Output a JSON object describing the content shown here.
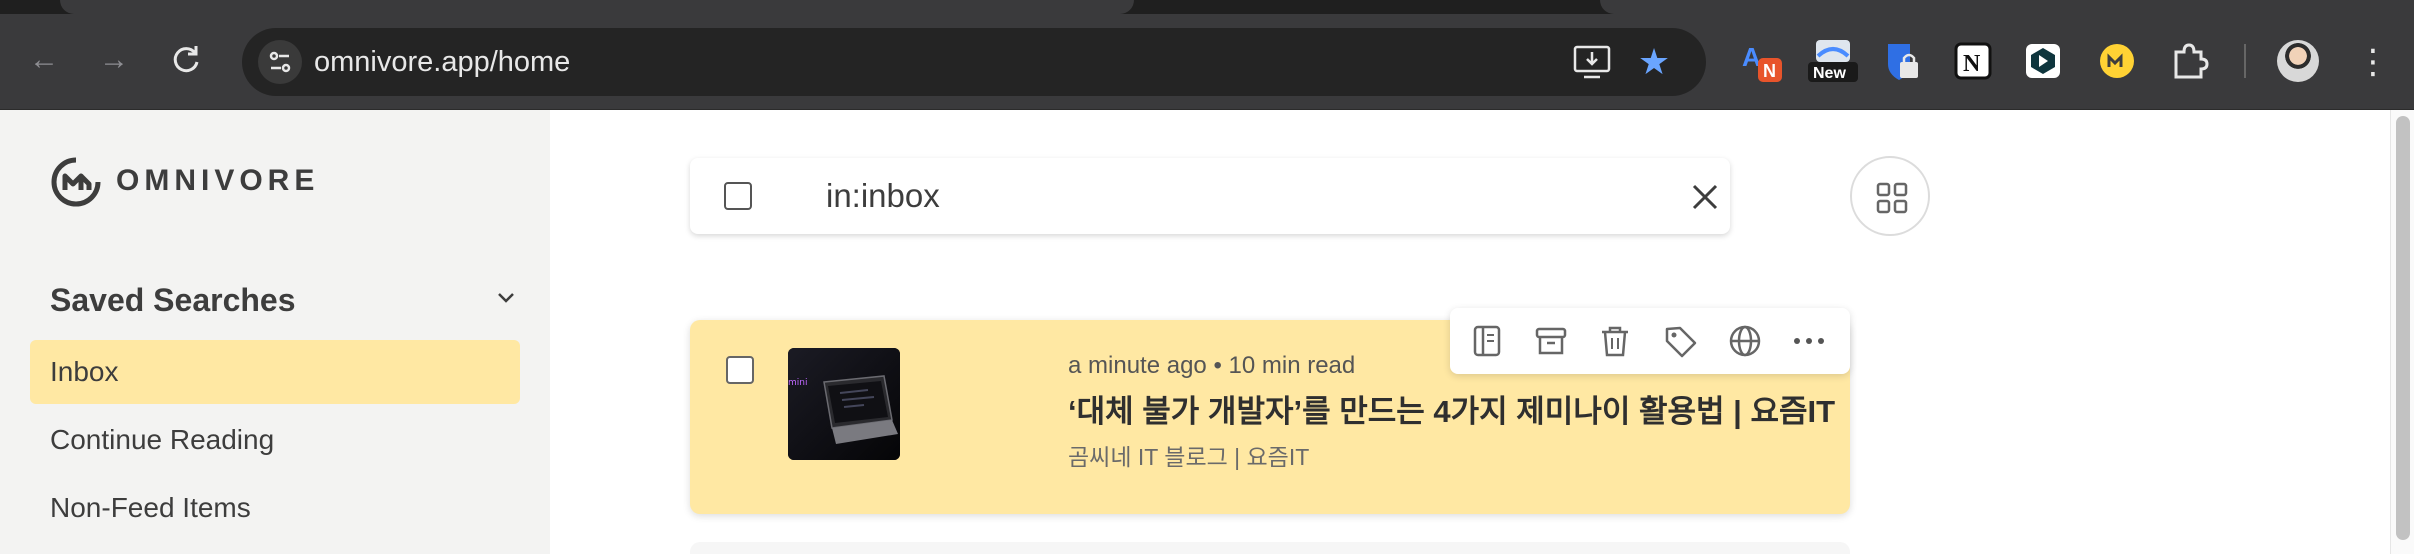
{
  "browser": {
    "url": "omnivore.app/home",
    "extensions": [
      {
        "name": "translate-extension",
        "badge": "N"
      },
      {
        "name": "new-extension",
        "badge": "New"
      },
      {
        "name": "bitwarden-extension"
      },
      {
        "name": "notion-extension"
      },
      {
        "name": "dashlane-extension"
      },
      {
        "name": "omnivore-extension"
      },
      {
        "name": "extensions-puzzle"
      }
    ]
  },
  "sidebar": {
    "brand": "OMNIVORE",
    "section_title": "Saved Searches",
    "items": [
      {
        "label": "Inbox",
        "active": true
      },
      {
        "label": "Continue Reading",
        "active": false
      },
      {
        "label": "Non-Feed Items",
        "active": false
      }
    ]
  },
  "search": {
    "query": "in:inbox"
  },
  "list": {
    "items": [
      {
        "time": "a minute ago",
        "separator": "•",
        "read_time": "10 min read",
        "title": "‘대체 불가 개발자’를 만드는 4가지 제미나이 활용법 | 요즘IT",
        "source": "곰씨네 IT 블로그 | 요즘IT",
        "thumb_text": "mini"
      }
    ]
  },
  "colors": {
    "accent": "#ffe8a3",
    "sidebar_bg": "#f3f3f2",
    "chrome_bg": "#3a3a3c",
    "star": "#6aa5ff"
  }
}
